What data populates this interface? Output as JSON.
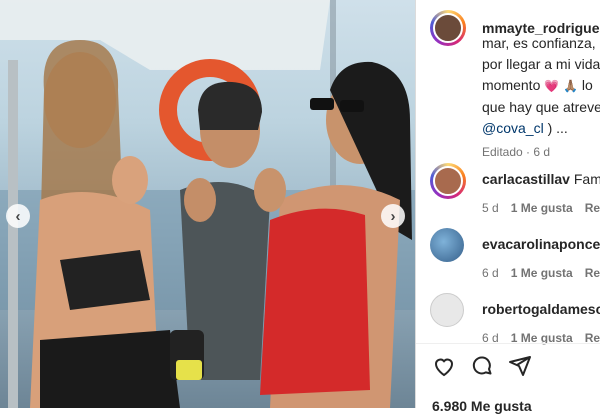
{
  "post": {
    "username": "mmayte_rodriguez",
    "caption_lines": [
      "mar, es confianza, e",
      "por llegar a mi vida",
      "momento",
      "que hay que atreve"
    ],
    "heart_emoji": "💗",
    "pray_emoji": "🙏🏽",
    "lo_text": " lo",
    "mention": "@cova_cl",
    "mention_after": " ) ...",
    "edited_label": "Editado",
    "edited_time": "6 d",
    "likes": "6.980 Me gusta"
  },
  "comments": [
    {
      "user": "carlacastillav",
      "text": "Famili",
      "time": "5 d",
      "likes": "1 Me gusta",
      "reply": "Resp"
    },
    {
      "user": "evacarolinaponce",
      "text": "",
      "time": "6 d",
      "likes": "1 Me gusta",
      "reply": "Resp"
    },
    {
      "user": "robertogaldamesca",
      "text": "",
      "time": "6 d",
      "likes": "1 Me gusta",
      "reply": "Resp"
    }
  ],
  "icons": [
    "heart-icon",
    "comment-icon",
    "share-icon",
    "chevron-left-icon",
    "chevron-right-icon"
  ],
  "colors": {
    "accent": "#00376b",
    "text": "#262626",
    "muted": "#737373"
  }
}
